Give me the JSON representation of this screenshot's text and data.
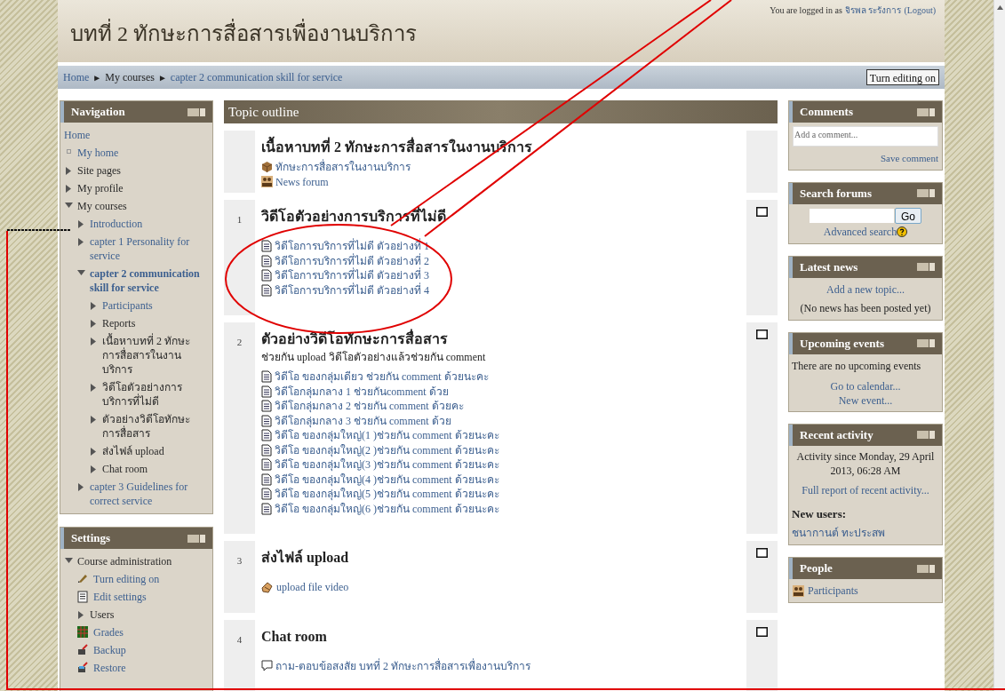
{
  "header": {
    "title": "บทที่ 2 ทักษะการสื่อสารเพื่องานบริการ",
    "login_prefix": "You are logged in as",
    "user": "จิรพล ระรังการ",
    "logout": "(Logout)"
  },
  "breadcrumb": {
    "items": [
      {
        "label": "Home",
        "link": true
      },
      {
        "label": "My courses",
        "link": false
      },
      {
        "label": "capter 2 communication skill for service",
        "link": true
      }
    ],
    "separator": "►",
    "edit_button": "Turn editing on"
  },
  "navigation": {
    "title": "Navigation",
    "items": [
      {
        "label": "Home",
        "kind": "root",
        "link": true
      },
      {
        "label": "My home",
        "kind": "leaf",
        "link": true
      },
      {
        "label": "Site pages",
        "kind": "branch",
        "link": false,
        "expanded": false
      },
      {
        "label": "My profile",
        "kind": "branch",
        "link": false,
        "expanded": false
      },
      {
        "label": "My courses",
        "kind": "branch",
        "link": false,
        "expanded": true,
        "children": [
          {
            "label": "Introduction",
            "kind": "branch",
            "link": true,
            "expanded": false
          },
          {
            "label": "capter 1 Personality for service",
            "kind": "branch",
            "link": true,
            "expanded": false
          },
          {
            "label": "capter 2 communication skill for service",
            "kind": "branch",
            "link": true,
            "current": true,
            "expanded": true,
            "children": [
              {
                "label": "Participants",
                "kind": "branch",
                "link": true,
                "expanded": false
              },
              {
                "label": "Reports",
                "kind": "branch",
                "link": false,
                "expanded": false
              },
              {
                "label": "เนื้อหาบทที่ 2 ทักษะการสื่อสารในงานบริการ",
                "kind": "branch",
                "link": false,
                "expanded": false
              },
              {
                "label": "วิดีโอตัวอย่างการบริการที่ไม่ดี",
                "kind": "branch",
                "link": false,
                "expanded": false
              },
              {
                "label": "ตัวอย่างวิดีโอทักษะการสื่อสาร",
                "kind": "branch",
                "link": false,
                "expanded": false
              },
              {
                "label": "ส่งไฟล์ upload",
                "kind": "branch",
                "link": false,
                "expanded": false
              },
              {
                "label": "Chat room",
                "kind": "branch",
                "link": false,
                "expanded": false
              }
            ]
          },
          {
            "label": "capter 3 Guidelines for correct service",
            "kind": "branch",
            "link": true,
            "expanded": false
          }
        ]
      }
    ]
  },
  "settings": {
    "title": "Settings",
    "items": [
      {
        "label": "Course administration",
        "kind": "branch",
        "link": false,
        "expanded": true,
        "children": [
          {
            "label": "Turn editing on",
            "kind": "edit",
            "link": true
          },
          {
            "label": "Edit settings",
            "kind": "settings",
            "link": true
          },
          {
            "label": "Users",
            "kind": "branch",
            "link": false,
            "expanded": false
          },
          {
            "label": "Grades",
            "kind": "grades",
            "link": true
          },
          {
            "label": "Backup",
            "kind": "backup",
            "link": true
          },
          {
            "label": "Restore",
            "kind": "restore",
            "link": true
          }
        ]
      }
    ]
  },
  "topic_outline": {
    "title": "Topic outline",
    "sections": [
      {
        "title": "เนื้อหาบทที่ 2 ทักษะการสื่อสารในงานบริการ",
        "activities": [
          {
            "label": "ทักษะการสื่อสารในงานบริการ",
            "kind": "package"
          },
          {
            "label": "News forum",
            "kind": "forum"
          }
        ]
      },
      {
        "number": "1",
        "title": "วิดีโอตัวอย่างการบริการที่ไม่ดี",
        "activities": [
          {
            "label": "วิดีโอการบริการที่ไม่ดี ตัวอย่างที่ 1",
            "kind": "resource"
          },
          {
            "label": "วิดีโอการบริการที่ไม่ดี ตัวอย่างที่ 2",
            "kind": "resource"
          },
          {
            "label": "วิดีโอการบริการที่ไม่ดี ตัวอย่างที่ 3",
            "kind": "resource"
          },
          {
            "label": "วิดีโอการบริการที่ไม่ดี ตัวอย่างที่ 4",
            "kind": "resource"
          }
        ]
      },
      {
        "number": "2",
        "title": "ตัวอย่างวิดีโอทักษะการสื่อสาร",
        "summary": "ช่วยกัน upload วิดีโอตัวอย่างแล้วช่วยกัน comment",
        "activities": [
          {
            "label": "วิดีโอ ของกลุ่มเดียว ช่วยกัน comment ด้วยนะคะ",
            "kind": "resource"
          },
          {
            "label": "วิดีโอกลุ่มกลาง 1 ช่วยกันcomment ด้วย",
            "kind": "resource"
          },
          {
            "label": "วิดีโอกลุ่มกลาง 2 ช่วยกัน comment ด้วยคะ",
            "kind": "resource"
          },
          {
            "label": "วิดีโอกลุ่มกลาง 3 ช่วยกัน comment ด้วย",
            "kind": "resource"
          },
          {
            "label": "วิดีโอ ของกลุ่มใหญ่(1 )ช่วยกัน comment ด้วยนะคะ",
            "kind": "resource"
          },
          {
            "label": "วิดีโอ ของกลุ่มใหญ่(2 )ช่วยกัน comment ด้วยนะคะ",
            "kind": "resource"
          },
          {
            "label": "วิดีโอ ของกลุ่มใหญ่(3 )ช่วยกัน comment ด้วยนะคะ",
            "kind": "resource"
          },
          {
            "label": "วิดีโอ ของกลุ่มใหญ่(4 )ช่วยกัน comment ด้วยนะคะ",
            "kind": "resource"
          },
          {
            "label": "วิดีโอ ของกลุ่มใหญ่(5 )ช่วยกัน comment ด้วยนะคะ",
            "kind": "resource"
          },
          {
            "label": "วิดีโอ ของกลุ่มใหญ่(6 )ช่วยกัน comment ด้วยนะคะ",
            "kind": "resource"
          }
        ]
      },
      {
        "number": "3",
        "title": "ส่งไฟล์ upload",
        "activities": [
          {
            "label": "upload file video",
            "kind": "assignment"
          }
        ]
      },
      {
        "number": "4",
        "title": "Chat room",
        "activities": [
          {
            "label": "ถาม-ตอบข้อสงสัย บทที่ 2 ทักษะการสื่อสารเพื่องานบริการ",
            "kind": "chat"
          }
        ]
      }
    ]
  },
  "comments": {
    "title": "Comments",
    "placeholder": "Add a comment...",
    "save": "Save comment"
  },
  "search_forums": {
    "title": "Search forums",
    "button": "Go",
    "advanced": "Advanced search"
  },
  "latest_news": {
    "title": "Latest news",
    "add": "Add a new topic...",
    "empty": "(No news has been posted yet)"
  },
  "upcoming_events": {
    "title": "Upcoming events",
    "empty": "There are no upcoming events",
    "links": [
      "Go to calendar...",
      "New event..."
    ]
  },
  "recent_activity": {
    "title": "Recent activity",
    "since": "Activity since Monday, 29 April 2013, 06:28 AM",
    "full_report": "Full report of recent activity...",
    "new_users_heading": "New users:",
    "users": [
      "ชนากานต์ ทะประสพ"
    ]
  },
  "people": {
    "title": "People",
    "participants": "Participants"
  }
}
